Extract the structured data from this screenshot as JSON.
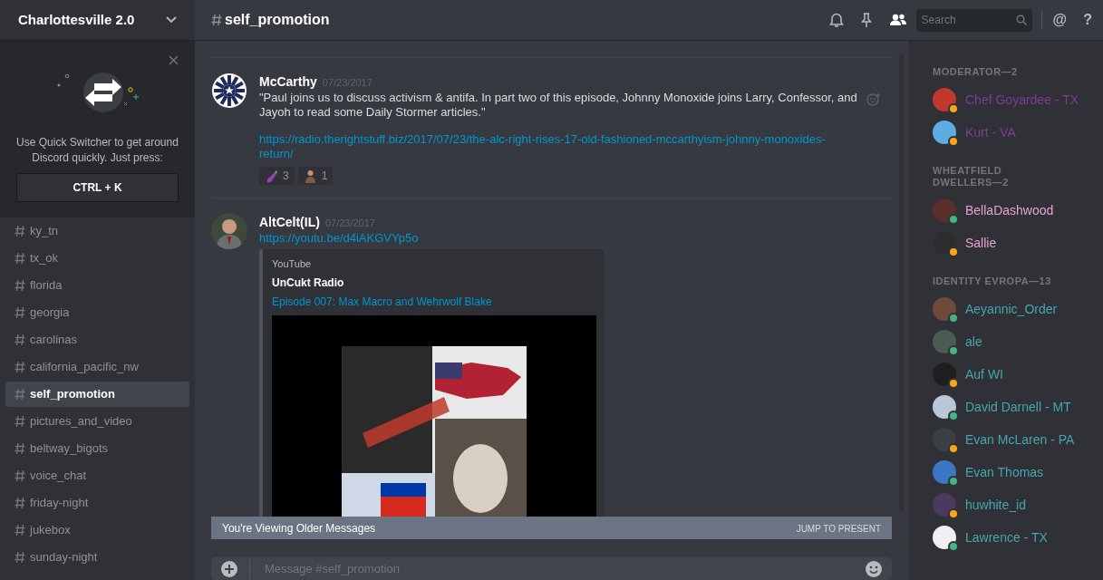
{
  "server": {
    "name": "Charlottesville 2.0"
  },
  "quick_switcher": {
    "text": "Use Quick Switcher to get around Discord quickly. Just press:",
    "shortcut": "CTRL + K"
  },
  "channels": [
    {
      "name": "ky_tn",
      "selected": false
    },
    {
      "name": "tx_ok",
      "selected": false
    },
    {
      "name": "florida",
      "selected": false
    },
    {
      "name": "georgia",
      "selected": false
    },
    {
      "name": "carolinas",
      "selected": false
    },
    {
      "name": "california_pacific_nw",
      "selected": false
    },
    {
      "name": "self_promotion",
      "selected": true
    },
    {
      "name": "pictures_and_video",
      "selected": false
    },
    {
      "name": "beltway_bigots",
      "selected": false
    },
    {
      "name": "voice_chat",
      "selected": false
    },
    {
      "name": "friday-night",
      "selected": false
    },
    {
      "name": "jukebox",
      "selected": false
    },
    {
      "name": "sunday-night",
      "selected": false
    }
  ],
  "header": {
    "channel": "self_promotion",
    "search_placeholder": "Search",
    "mention_glyph": "@",
    "help_glyph": "?"
  },
  "messages": [
    {
      "author": "McCarthy",
      "timestamp": "07/23/2017",
      "text": "\"Paul joins us to discuss activism & antifa. In part two of this episode, Johnny Monoxide joins Larry, Confessor, and Jayoh to read some Daily Stormer articles.\"",
      "link": "https://radio.therightstuff.biz/2017/07/23/the-alc-right-rises-17-old-fashioned-mccarthyism-johnny-monoxides-return/",
      "reactions": [
        {
          "kind": "eggplant",
          "count": "3"
        },
        {
          "kind": "figure",
          "count": "1"
        }
      ]
    },
    {
      "author": "AltCelt(IL)",
      "timestamp": "07/23/2017",
      "link": "https://youtu.be/d4iAKGVYp5o",
      "embed": {
        "provider": "YouTube",
        "title": "UnCukt Radio",
        "link": "Episode 007: Max Macro and Wehrwolf Blake",
        "kind": "picture"
      }
    }
  ],
  "older_banner": {
    "text": "You're Viewing Older Messages",
    "action": "JUMP TO PRESENT"
  },
  "composer": {
    "placeholder": "Message #self_promotion"
  },
  "member_sections": [
    {
      "title": "MODERATOR—2",
      "color": "#7d3c98",
      "members": [
        {
          "name": "Chef Goyardee - TX",
          "color": "#faa61a"
        },
        {
          "name": "Kurt - VA",
          "color": "#faa61a"
        }
      ]
    },
    {
      "title": "WHEATFIELD DWELLERS—2",
      "color": "#e8a0d6",
      "members": [
        {
          "name": "BellaDashwood",
          "color": "#43b581"
        },
        {
          "name": "Sallie",
          "color": "#faa61a"
        }
      ]
    },
    {
      "title": "IDENTITY EVROPA—13",
      "color": "#46a6ad",
      "members": [
        {
          "name": "Aeyannic_Order",
          "color": "#43b581"
        },
        {
          "name": "ale",
          "color": "#43b581"
        },
        {
          "name": "Auf WI",
          "color": "#faa61a"
        },
        {
          "name": "David Darnell - MT",
          "color": "#43b581"
        },
        {
          "name": "Evan McLaren - PA",
          "color": "#faa61a"
        },
        {
          "name": "Evan Thomas",
          "color": "#43b581"
        },
        {
          "name": "huwhite_id",
          "color": "#faa61a"
        },
        {
          "name": "Lawrence - TX",
          "color": "#43b581"
        }
      ]
    }
  ]
}
